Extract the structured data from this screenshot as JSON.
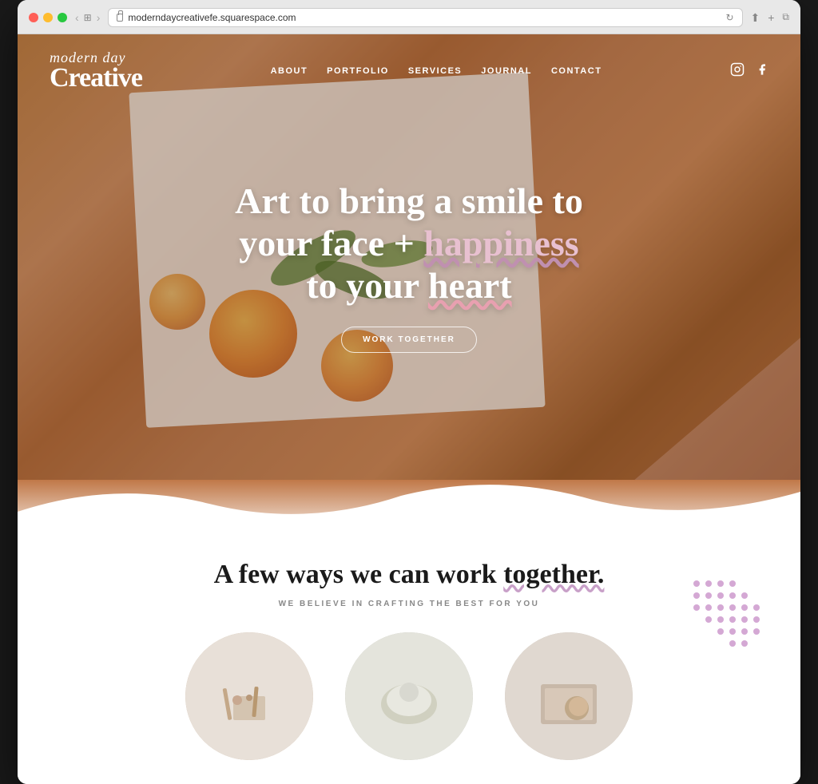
{
  "browser": {
    "url": "moderndaycreativefe.squarespace.com",
    "traffic_lights": [
      "close",
      "minimize",
      "maximize"
    ]
  },
  "nav": {
    "logo_script": "modern day",
    "logo_bold": "Creative",
    "links": [
      {
        "label": "About",
        "key": "about"
      },
      {
        "label": "Portfolio",
        "key": "portfolio"
      },
      {
        "label": "Services",
        "key": "services",
        "active": true
      },
      {
        "label": "Journal",
        "key": "journal"
      },
      {
        "label": "Contact",
        "key": "contact"
      }
    ],
    "social": [
      {
        "icon": "instagram",
        "label": "Instagram"
      },
      {
        "icon": "facebook",
        "label": "Facebook"
      }
    ]
  },
  "hero": {
    "heading_line1": "Art to bring a smile to",
    "heading_line2": "your face + happiness",
    "heading_line3": "to your heart",
    "cta_button": "Work Together"
  },
  "section": {
    "heading": "A few ways we can work together.",
    "subheading": "We believe in crafting the best for you",
    "circles": [
      {
        "label": "circle-1"
      },
      {
        "label": "circle-2"
      },
      {
        "label": "circle-3"
      }
    ]
  }
}
